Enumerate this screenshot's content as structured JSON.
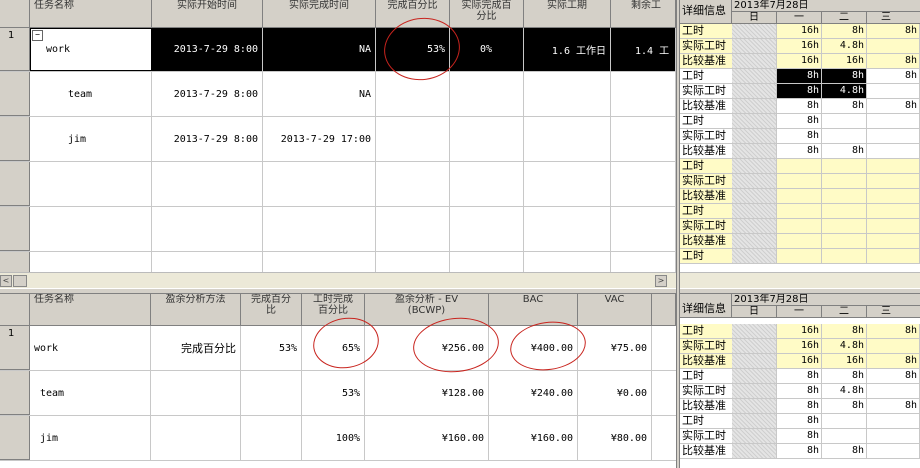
{
  "top_table": {
    "columns": [
      "任务名称",
      "实际开始时间",
      "实际完成时间",
      "完成百分比",
      "实际完成百\n分比",
      "实际工期",
      "剩余工"
    ],
    "rows": [
      {
        "num": "1",
        "collapse": "−",
        "name": "work",
        "start": "2013-7-29 8:00",
        "finish": "NA",
        "pct": "53%",
        "actual_pct": "0%",
        "actual_dur": "1.6 工作日",
        "remaining": "1.4 工"
      },
      {
        "num": "",
        "name": "team",
        "start": "2013-7-29 8:00",
        "finish": "NA",
        "pct": "",
        "actual_pct": "",
        "actual_dur": "",
        "remaining": ""
      },
      {
        "num": "",
        "name": "jim",
        "start": "2013-7-29 8:00",
        "finish": "2013-7-29 17:00",
        "pct": "",
        "actual_pct": "",
        "actual_dur": "",
        "remaining": ""
      }
    ]
  },
  "bottom_table": {
    "columns": [
      "任务名称",
      "盈余分析方法",
      "完成百分\n比",
      "工时完成\n百分比",
      "盈余分析 - EV\n(BCWP)",
      "BAC",
      "VAC"
    ],
    "rows": [
      {
        "num": "1",
        "name": "work",
        "method": "完成百分比",
        "pct": "53%",
        "work_pct": "65%",
        "ev": "¥256.00",
        "bac": "¥400.00",
        "vac": "¥75.00"
      },
      {
        "num": "",
        "name": "team",
        "method": "",
        "pct": "",
        "work_pct": "53%",
        "ev": "¥128.00",
        "bac": "¥240.00",
        "vac": "¥0.00"
      },
      {
        "num": "",
        "name": "jim",
        "method": "",
        "pct": "",
        "work_pct": "100%",
        "ev": "¥160.00",
        "bac": "¥160.00",
        "vac": "¥80.00"
      }
    ]
  },
  "top_detail": {
    "header_label": "详细信息",
    "week_label": "2013年7月28日",
    "days": [
      "日",
      "一",
      "二",
      "三"
    ],
    "rows": [
      {
        "label": "工时",
        "style": "yellow",
        "values": [
          "",
          "16h",
          "8h",
          "8h"
        ]
      },
      {
        "label": "实际工时",
        "style": "yellow",
        "values": [
          "",
          "16h",
          "4.8h",
          ""
        ]
      },
      {
        "label": "比较基准",
        "style": "yellow",
        "values": [
          "",
          "16h",
          "16h",
          "8h"
        ]
      },
      {
        "label": "工时",
        "style": "black",
        "values": [
          "",
          "8h",
          "8h",
          "8h"
        ]
      },
      {
        "label": "实际工时",
        "style": "black",
        "values": [
          "",
          "8h",
          "4.8h",
          ""
        ]
      },
      {
        "label": "比较基准",
        "style": "plain",
        "values": [
          "",
          "8h",
          "8h",
          "8h"
        ]
      },
      {
        "label": "工时",
        "style": "plain",
        "values": [
          "",
          "8h",
          "",
          ""
        ]
      },
      {
        "label": "实际工时",
        "style": "plain",
        "values": [
          "",
          "8h",
          "",
          ""
        ]
      },
      {
        "label": "比较基准",
        "style": "plain",
        "values": [
          "",
          "8h",
          "8h",
          ""
        ]
      },
      {
        "label": "工时",
        "style": "yellow",
        "values": [
          "",
          "",
          "",
          ""
        ]
      },
      {
        "label": "实际工时",
        "style": "yellow",
        "values": [
          "",
          "",
          "",
          ""
        ]
      },
      {
        "label": "比较基准",
        "style": "yellow",
        "values": [
          "",
          "",
          "",
          ""
        ]
      },
      {
        "label": "工时",
        "style": "yellow",
        "values": [
          "",
          "",
          "",
          ""
        ]
      },
      {
        "label": "实际工时",
        "style": "yellow",
        "values": [
          "",
          "",
          "",
          ""
        ]
      },
      {
        "label": "比较基准",
        "style": "yellow",
        "values": [
          "",
          "",
          "",
          ""
        ]
      },
      {
        "label": "工时",
        "style": "yellow",
        "values": [
          "",
          "",
          "",
          ""
        ]
      }
    ]
  },
  "bottom_detail": {
    "header_label": "详细信息",
    "week_label": "2013年7月28日",
    "days": [
      "日",
      "一",
      "二",
      "三"
    ],
    "rows": [
      {
        "label": "工时",
        "style": "yellow",
        "values": [
          "",
          "16h",
          "8h",
          "8h"
        ]
      },
      {
        "label": "实际工时",
        "style": "yellow",
        "values": [
          "",
          "16h",
          "4.8h",
          ""
        ]
      },
      {
        "label": "比较基准",
        "style": "yellow",
        "values": [
          "",
          "16h",
          "16h",
          "8h"
        ]
      },
      {
        "label": "工时",
        "style": "plain",
        "values": [
          "",
          "8h",
          "8h",
          "8h"
        ]
      },
      {
        "label": "实际工时",
        "style": "plain",
        "values": [
          "",
          "8h",
          "4.8h",
          ""
        ]
      },
      {
        "label": "比较基准",
        "style": "plain",
        "values": [
          "",
          "8h",
          "8h",
          "8h"
        ]
      },
      {
        "label": "工时",
        "style": "plain",
        "values": [
          "",
          "8h",
          "",
          ""
        ]
      },
      {
        "label": "实际工时",
        "style": "plain",
        "values": [
          "",
          "8h",
          "",
          ""
        ]
      },
      {
        "label": "比较基准",
        "style": "plain",
        "values": [
          "",
          "8h",
          "8h",
          ""
        ]
      }
    ]
  },
  "scrollbar": {
    "left_arrow": "<",
    "right_arrow": ">"
  },
  "colors": {
    "highlight_row": "#000000",
    "detail_yellow": "#fffbc6",
    "annotation_circle": "#c8241e",
    "header_gray": "#d4d0c8"
  }
}
